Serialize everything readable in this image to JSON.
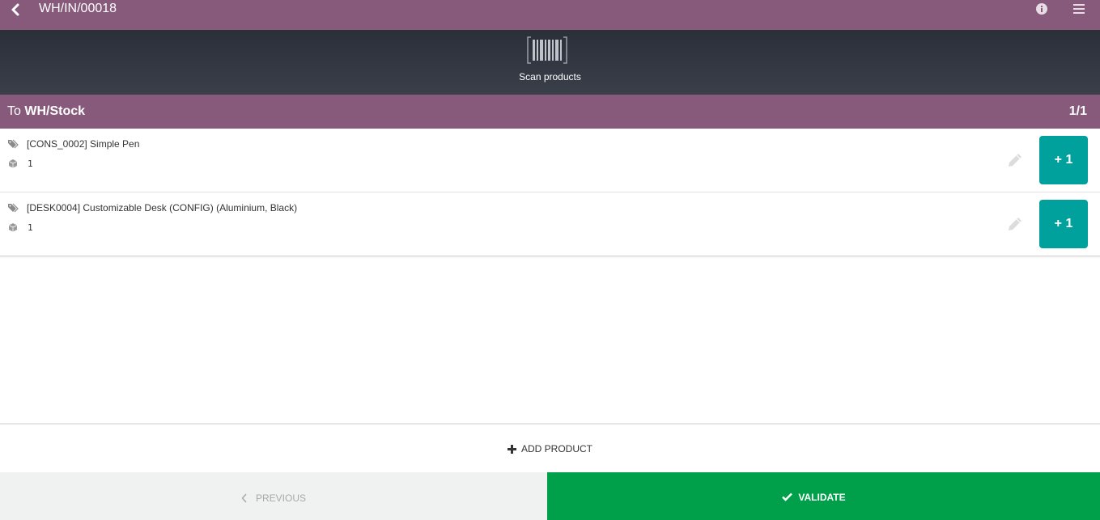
{
  "header": {
    "title": "WH/IN/00018",
    "back_icon": "chevron-left-icon",
    "info_icon": "info-circle-icon",
    "menu_icon": "hamburger-menu-icon"
  },
  "scan": {
    "label": "Scan products",
    "icon": "barcode-icon"
  },
  "location": {
    "prefix": "To",
    "name": "WH/Stock",
    "page": "1/1"
  },
  "lines": [
    {
      "product": "[CONS_0002] Simple Pen",
      "qty": "1",
      "plus_label": "+ 1"
    },
    {
      "product": "[DESK0004] Customizable Desk (CONFIG) (Aluminium, Black)",
      "qty": "1",
      "plus_label": "+ 1"
    }
  ],
  "actions": {
    "add_product": "ADD PRODUCT",
    "previous": "PREVIOUS",
    "validate": "VALIDATE"
  },
  "colors": {
    "header": "#875a7b",
    "scanbar": "#2e333d",
    "plus_button": "#00a09d",
    "validate": "#00a04a",
    "previous_bg": "#f0f2f2"
  }
}
